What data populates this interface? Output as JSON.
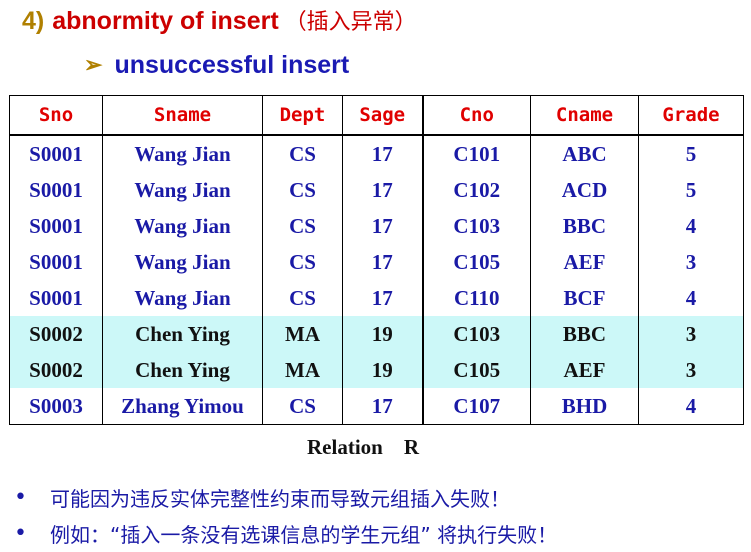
{
  "heading": {
    "number": "4)",
    "title": "abnormity of insert",
    "title_cn": "（插入异常）"
  },
  "subheading": {
    "arrow": "➢",
    "text": "unsuccessful insert"
  },
  "table": {
    "columns": [
      "Sno",
      "Sname",
      "Dept",
      "Sage",
      "Cno",
      "Cname",
      "Grade"
    ],
    "rows": [
      {
        "cells": [
          "S0001",
          "Wang Jian",
          "CS",
          "17",
          "C101",
          "ABC",
          "5"
        ],
        "highlight": false
      },
      {
        "cells": [
          "S0001",
          "Wang Jian",
          "CS",
          "17",
          "C102",
          "ACD",
          "5"
        ],
        "highlight": false
      },
      {
        "cells": [
          "S0001",
          "Wang Jian",
          "CS",
          "17",
          "C103",
          "BBC",
          "4"
        ],
        "highlight": false
      },
      {
        "cells": [
          "S0001",
          "Wang Jian",
          "CS",
          "17",
          "C105",
          "AEF",
          "3"
        ],
        "highlight": false
      },
      {
        "cells": [
          "S0001",
          "Wang Jian",
          "CS",
          "17",
          "C110",
          "BCF",
          "4"
        ],
        "highlight": false
      },
      {
        "cells": [
          "S0002",
          "Chen Ying",
          "MA",
          "19",
          "C103",
          "BBC",
          "3"
        ],
        "highlight": true
      },
      {
        "cells": [
          "S0002",
          "Chen Ying",
          "MA",
          "19",
          "C105",
          "AEF",
          "3"
        ],
        "highlight": true
      },
      {
        "cells": [
          "S0003",
          "Zhang Yimou",
          "CS",
          "17",
          "C107",
          "BHD",
          "4"
        ],
        "highlight": false
      }
    ]
  },
  "caption": "Relation    R",
  "bullets": [
    {
      "marker": "•",
      "text": "可能因为违反实体完整性约束而导致元组插入失败！"
    },
    {
      "marker": "•",
      "text": "例如：“插入一条没有选课信息的学生元组” 将执行失败！"
    }
  ],
  "colors": {
    "header_text": "#e00000",
    "body_text": "#1a1aa6",
    "highlight_row_bg": "#ccf8f8",
    "title": "#cc0000",
    "number": "#b08000"
  }
}
